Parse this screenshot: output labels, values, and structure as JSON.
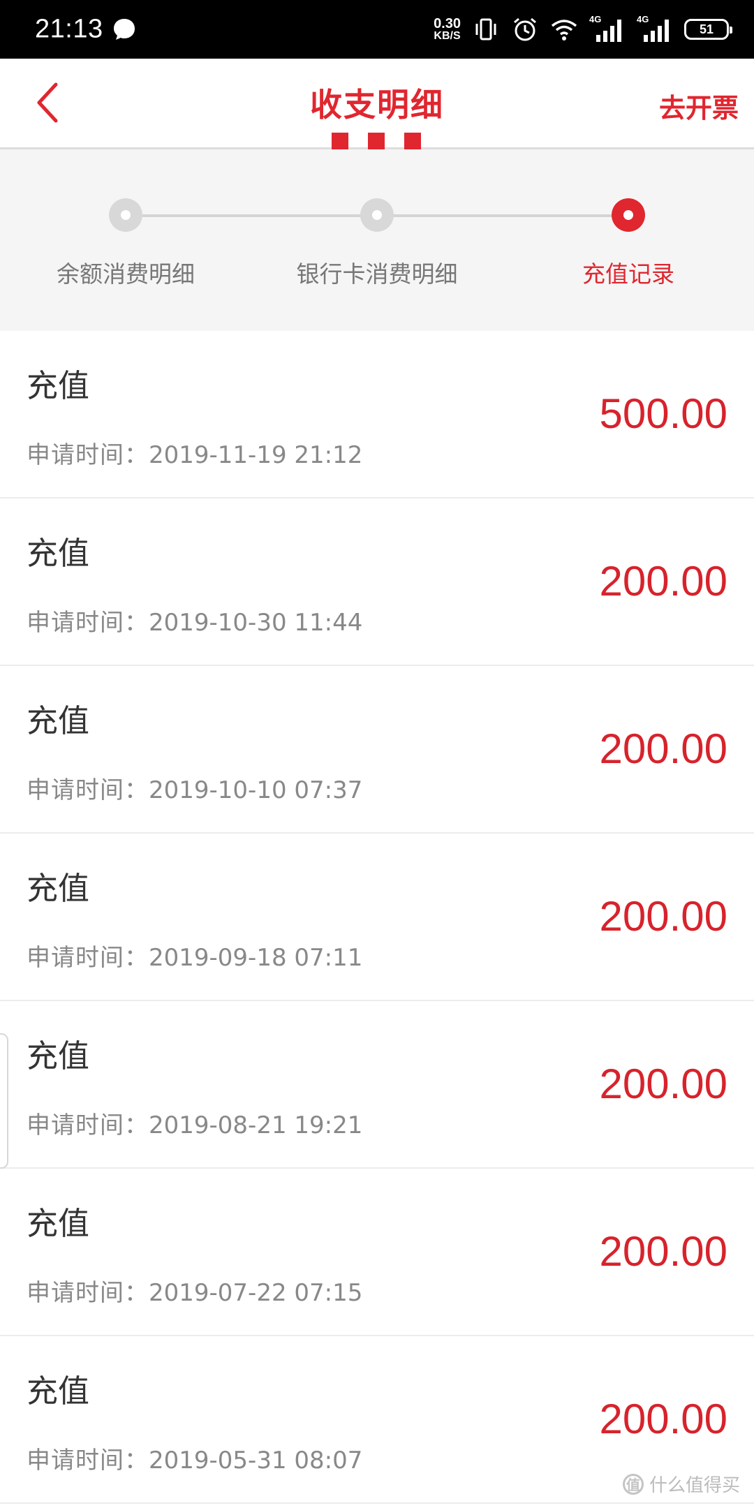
{
  "status_bar": {
    "time": "21:13",
    "net_speed_value": "0.30",
    "net_speed_unit": "KB/S",
    "signal_label_1": "4G",
    "signal_label_2": "4G",
    "battery": "51"
  },
  "header": {
    "title": "收支明细",
    "action": "去开票"
  },
  "tabs": [
    {
      "label": "余额消费明细",
      "active": false
    },
    {
      "label": "银行卡消费明细",
      "active": false
    },
    {
      "label": "充值记录",
      "active": true
    }
  ],
  "records": [
    {
      "title": "充值",
      "time_label": "申请时间：",
      "time": "2019-11-19 21:12",
      "amount": "500.00"
    },
    {
      "title": "充值",
      "time_label": "申请时间：",
      "time": "2019-10-30 11:44",
      "amount": "200.00"
    },
    {
      "title": "充值",
      "time_label": "申请时间：",
      "time": "2019-10-10 07:37",
      "amount": "200.00"
    },
    {
      "title": "充值",
      "time_label": "申请时间：",
      "time": "2019-09-18 07:11",
      "amount": "200.00"
    },
    {
      "title": "充值",
      "time_label": "申请时间：",
      "time": "2019-08-21 19:21",
      "amount": "200.00"
    },
    {
      "title": "充值",
      "time_label": "申请时间：",
      "time": "2019-07-22 07:15",
      "amount": "200.00"
    },
    {
      "title": "充值",
      "time_label": "申请时间：",
      "time": "2019-05-31 08:07",
      "amount": "200.00"
    }
  ],
  "watermark": {
    "logo": "值",
    "text": "什么值得买"
  },
  "colors": {
    "accent": "#e0262f",
    "amount": "#d7232c",
    "status_bar": "#000000",
    "tab_background": "#f5f5f5"
  }
}
